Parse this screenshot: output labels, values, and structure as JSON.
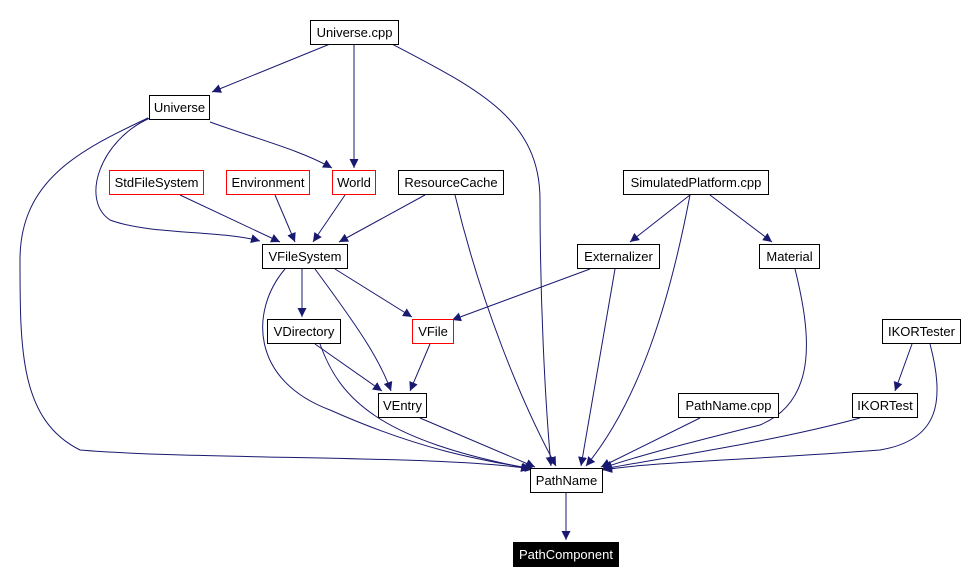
{
  "graph": {
    "edge_color": "#191970",
    "nodes": [
      {
        "id": "universe_cpp",
        "label": "Universe.cpp",
        "border": "black"
      },
      {
        "id": "universe",
        "label": "Universe",
        "border": "black"
      },
      {
        "id": "stdfilesystem",
        "label": "StdFileSystem",
        "border": "red"
      },
      {
        "id": "environment",
        "label": "Environment",
        "border": "red"
      },
      {
        "id": "world",
        "label": "World",
        "border": "red"
      },
      {
        "id": "resourcecache",
        "label": "ResourceCache",
        "border": "black"
      },
      {
        "id": "simulatedplatform_cpp",
        "label": "SimulatedPlatform.cpp",
        "border": "black"
      },
      {
        "id": "vfilesystem",
        "label": "VFileSystem",
        "border": "black"
      },
      {
        "id": "externalizer",
        "label": "Externalizer",
        "border": "black"
      },
      {
        "id": "material",
        "label": "Material",
        "border": "black"
      },
      {
        "id": "vdirectory",
        "label": "VDirectory",
        "border": "black"
      },
      {
        "id": "vfile",
        "label": "VFile",
        "border": "red"
      },
      {
        "id": "ikortester",
        "label": "IKORTester",
        "border": "black"
      },
      {
        "id": "ventry",
        "label": "VEntry",
        "border": "black"
      },
      {
        "id": "pathname_cpp",
        "label": "PathName.cpp",
        "border": "black"
      },
      {
        "id": "ikortest",
        "label": "IKORTest",
        "border": "black"
      },
      {
        "id": "pathname",
        "label": "PathName",
        "border": "black"
      },
      {
        "id": "pathcomponent",
        "label": "PathComponent",
        "border": "filled-black"
      }
    ],
    "edges": [
      [
        "universe_cpp",
        "universe"
      ],
      [
        "universe_cpp",
        "world"
      ],
      [
        "universe_cpp",
        "pathname"
      ],
      [
        "universe",
        "world"
      ],
      [
        "universe",
        "vfilesystem"
      ],
      [
        "universe",
        "pathname"
      ],
      [
        "stdfilesystem",
        "vfilesystem"
      ],
      [
        "environment",
        "vfilesystem"
      ],
      [
        "world",
        "vfilesystem"
      ],
      [
        "resourcecache",
        "vfilesystem"
      ],
      [
        "resourcecache",
        "pathname"
      ],
      [
        "simulatedplatform_cpp",
        "externalizer"
      ],
      [
        "simulatedplatform_cpp",
        "material"
      ],
      [
        "simulatedplatform_cpp",
        "pathname"
      ],
      [
        "vfilesystem",
        "vdirectory"
      ],
      [
        "vfilesystem",
        "vfile"
      ],
      [
        "vfilesystem",
        "ventry"
      ],
      [
        "vfilesystem",
        "pathname"
      ],
      [
        "externalizer",
        "vfile"
      ],
      [
        "externalizer",
        "pathname"
      ],
      [
        "material",
        "pathname"
      ],
      [
        "vdirectory",
        "ventry"
      ],
      [
        "vdirectory",
        "pathname"
      ],
      [
        "vfile",
        "ventry"
      ],
      [
        "ventry",
        "pathname"
      ],
      [
        "pathname_cpp",
        "pathname"
      ],
      [
        "ikortester",
        "ikortest"
      ],
      [
        "ikortester",
        "pathname"
      ],
      [
        "ikortest",
        "pathname"
      ],
      [
        "pathname",
        "pathcomponent"
      ]
    ]
  }
}
